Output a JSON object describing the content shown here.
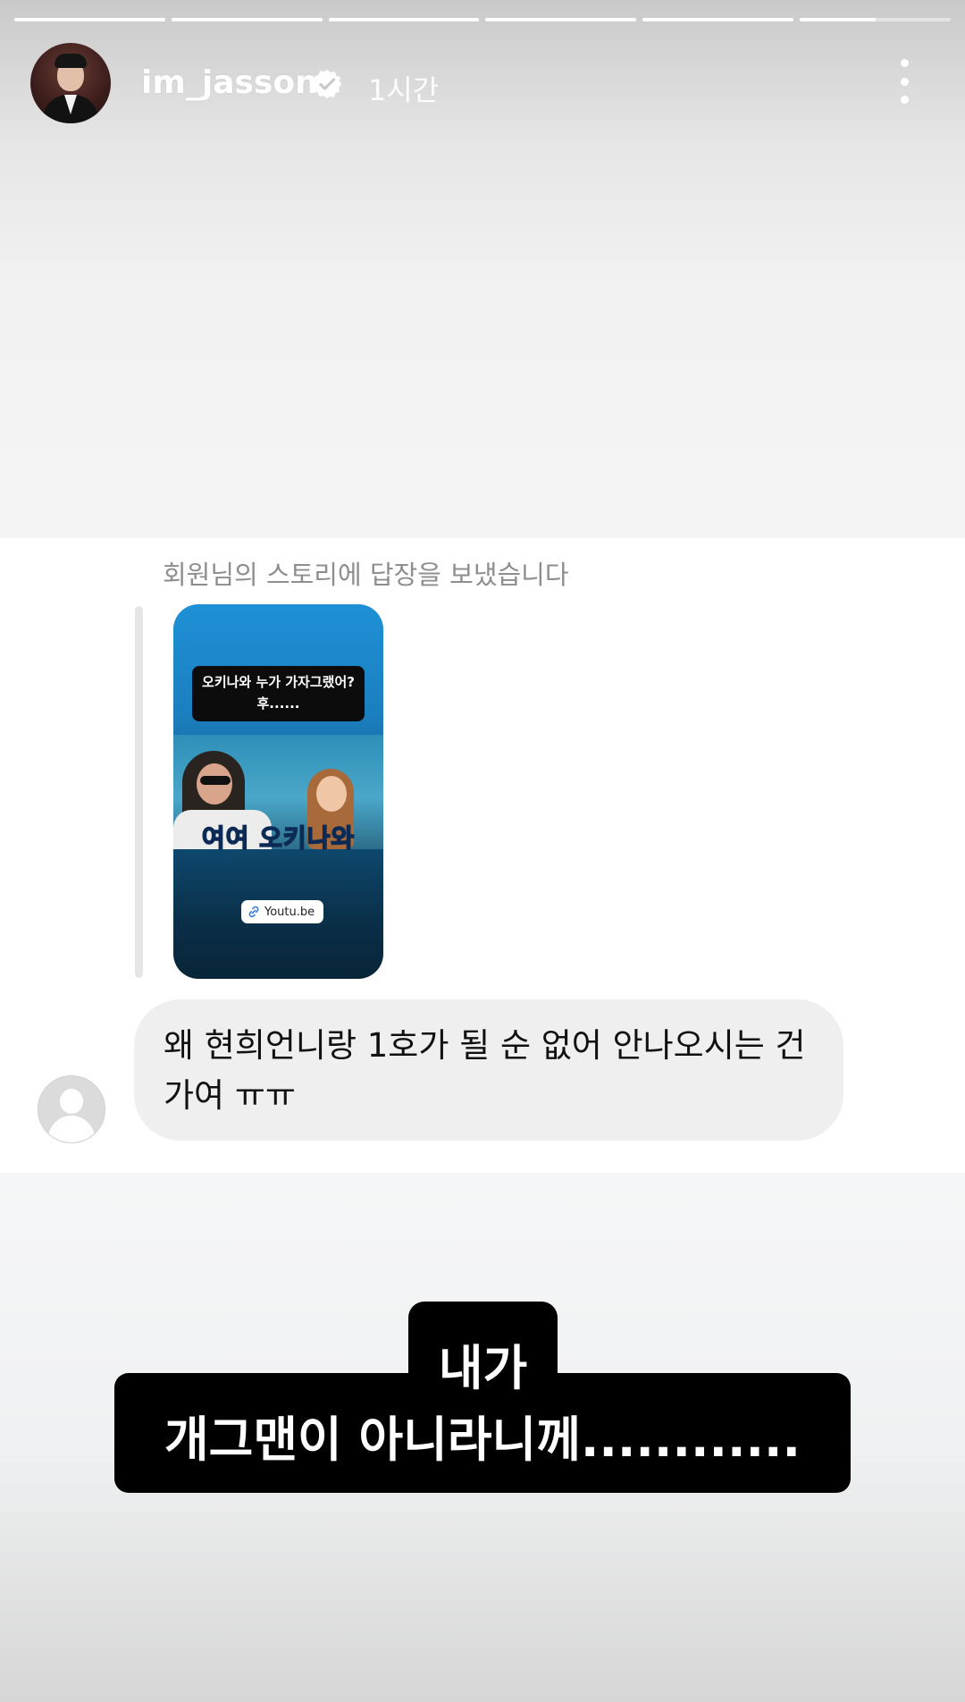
{
  "story": {
    "progress": [
      1,
      1,
      1,
      1,
      1,
      0.5
    ],
    "username": "im_jasson",
    "verified": true,
    "time_ago": "1시간",
    "more_icon": "more-vertical-icon"
  },
  "screenshot": {
    "reply_note": "회원님의 스토리에 답장을 보냈습니다",
    "thumbnail": {
      "caption_line1": "오키나와 누가 가자그랬어?",
      "caption_line2": "후......",
      "title": "여여 오키나와",
      "link_label": "Youtu.be"
    },
    "message": "왜 현희언니랑 1호가 될 순 없어 안나오시는 건가여 ㅠㅠ"
  },
  "caption": {
    "line1": "내가",
    "line2": "개그맨이 아니라니께............"
  }
}
